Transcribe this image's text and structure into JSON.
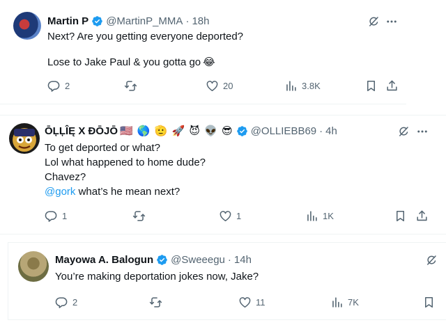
{
  "tweets": [
    {
      "name": "Martin P",
      "handle": "@MartinP_MMA",
      "time": "18h",
      "lines": [
        "Next? Are you getting everyone deported?",
        "Lose to Jake Paul & you gotta go"
      ],
      "trailing_emoji": "😂",
      "replies": "2",
      "likes": "20",
      "views": "3.8K"
    },
    {
      "name": "ŌĻĻÎĘ X ĐŌJŌ",
      "name_emojis": "🇺🇸 🌎 🫡 🚀 😈 👽 😎",
      "handle": "@OLLIEBB69",
      "time": "4h",
      "lines": [
        "To get deported or what?",
        "Lol what happened to home dude?",
        "Chavez?"
      ],
      "mention": "@gork",
      "mention_rest": " what’s he mean next?",
      "replies": "1",
      "likes": "1",
      "views": "1K"
    },
    {
      "name": "Mayowa A. Balogun",
      "handle": "@Sweeegu",
      "time": "14h",
      "lines": [
        "You’re making deportation jokes now, Jake?"
      ],
      "replies": "2",
      "likes": "11",
      "views": "7K"
    }
  ],
  "separator": "·",
  "colors": {
    "verified": "#1d9bf0",
    "muted": "#536471",
    "link": "#1d9bf0"
  },
  "icons": [
    "verified-badge-icon",
    "grok-icon",
    "more-icon",
    "reply-icon",
    "retweet-icon",
    "like-icon",
    "views-icon",
    "bookmark-icon",
    "share-icon"
  ]
}
